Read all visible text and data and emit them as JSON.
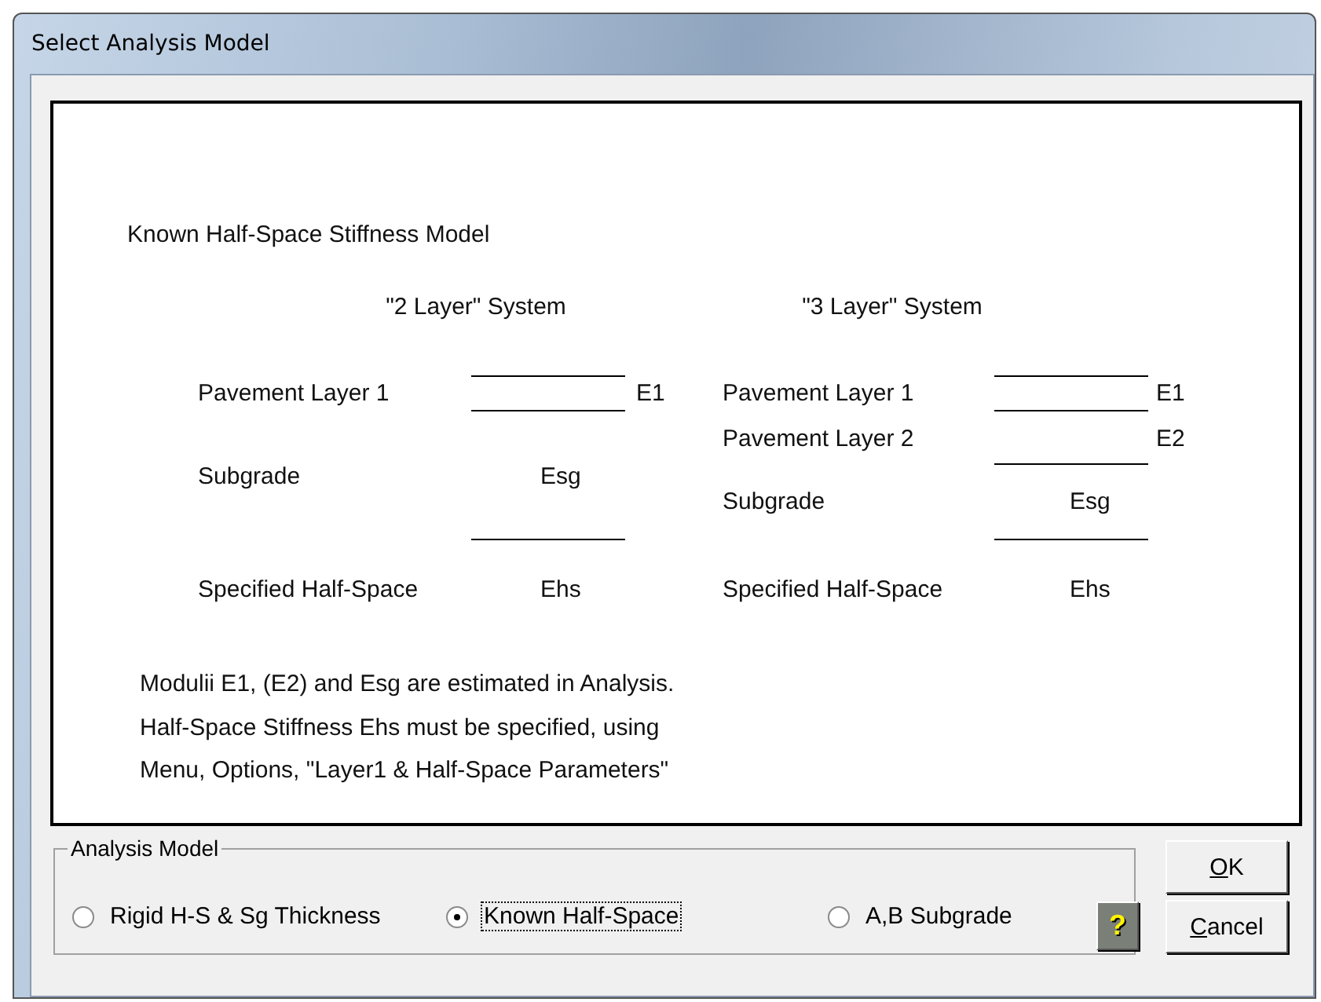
{
  "window": {
    "title": "Select Analysis Model"
  },
  "diagram": {
    "heading": "Known Half-Space Stiffness Model",
    "systems": [
      {
        "title": "\"2 Layer\" System",
        "rows": [
          {
            "label": "Pavement Layer 1",
            "symbol": "E1"
          },
          {
            "label": "Subgrade",
            "symbol": "Esg"
          },
          {
            "label": "Specified Half-Space",
            "symbol": "Ehs"
          }
        ]
      },
      {
        "title": "\"3 Layer\" System",
        "rows": [
          {
            "label": "Pavement Layer 1",
            "symbol": "E1"
          },
          {
            "label": "Pavement Layer 2",
            "symbol": "E2"
          },
          {
            "label": "Subgrade",
            "symbol": "Esg"
          },
          {
            "label": "Specified Half-Space",
            "symbol": "Ehs"
          }
        ]
      }
    ],
    "notes": [
      "Modulii E1, (E2) and Esg are estimated in Analysis.",
      "Half-Space Stiffness Ehs must be specified, using",
      "Menu, Options, \"Layer1 & Half-Space Parameters\""
    ]
  },
  "analysis_model": {
    "legend": "Analysis Model",
    "options": [
      {
        "label": "Rigid H-S & Sg Thickness",
        "selected": false,
        "focused": false
      },
      {
        "label": "Known Half-Space",
        "selected": true,
        "focused": true
      },
      {
        "label": "A,B Subgrade",
        "selected": false,
        "focused": false
      }
    ]
  },
  "help_button": {
    "label": "?"
  },
  "buttons": [
    {
      "label": "OK"
    },
    {
      "label": "Cancel"
    }
  ]
}
